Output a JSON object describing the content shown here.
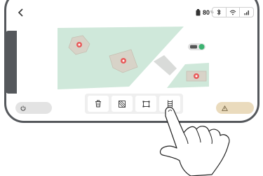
{
  "status_bar": {
    "battery_percent": "80",
    "battery_unit": "%",
    "icons": [
      "battery-icon",
      "bluetooth-icon",
      "wifi-icon",
      "signal-icon"
    ]
  },
  "nav": {
    "back_icon": "chevron-left-icon"
  },
  "map": {
    "zone_color": "#cfe8da",
    "obstacle_color": "#d8d3c8",
    "marker_color": "#e85a5a"
  },
  "toolbar": {
    "tools": [
      {
        "name": "delete",
        "icon": "trash-icon"
      },
      {
        "name": "no-go",
        "icon": "hatched-square-icon"
      },
      {
        "name": "frame",
        "icon": "frame-icon"
      },
      {
        "name": "ladder",
        "icon": "ladder-icon"
      }
    ]
  },
  "left_control": {
    "icon": "power-icon"
  },
  "right_control": {
    "icon": "warning-icon",
    "color": "#eadbbd"
  },
  "robot": {
    "icon": "robot-mower-icon",
    "status_color": "#3cb371"
  }
}
